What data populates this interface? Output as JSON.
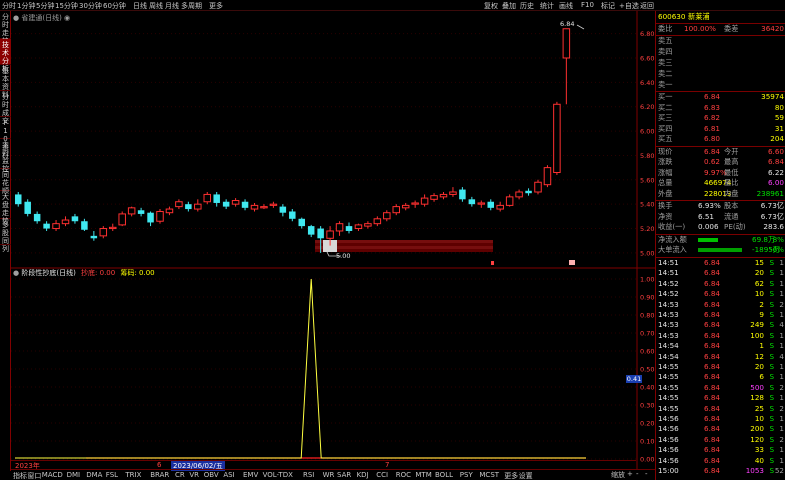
{
  "topbar": {
    "left": [
      "分时",
      "1分钟",
      "5分钟",
      "15分钟",
      "30分钟",
      "60分钟",
      "日线",
      "周线",
      "月线",
      "多周期",
      "更多"
    ],
    "right": [
      "复权",
      "叠加",
      "历史",
      "统计",
      "画线",
      "F10",
      "标记",
      "+自选",
      "返回"
    ]
  },
  "left_tabs": [
    "分时走势",
    "技术分析",
    "基本资料",
    "分时成交",
    "F10资料",
    "主力监控",
    "同花顺",
    "大盘走势",
    "多股同列"
  ],
  "main_title": "省建通(日线)",
  "indicator": {
    "title": "阶段性抄底(日线)",
    "label1": "抄底: 0.00",
    "label2": "筹码: 0.00"
  },
  "low_marker": "5.00",
  "high_marker": "6.84",
  "axis_main": [
    "6.80",
    "6.60",
    "6.40",
    "6.20",
    "6.00",
    "5.80",
    "5.60",
    "5.40",
    "5.20",
    "5.00"
  ],
  "axis_ind": [
    "1.00",
    "0.90",
    "0.80",
    "0.70",
    "0.60",
    "0.50",
    "0.40",
    "0.30",
    "0.20",
    "0.10",
    "0.00"
  ],
  "ind_value_box": "0.41",
  "timeline": {
    "year": "2023年",
    "m6": "6",
    "date": "2023/06/02/五",
    "m7": "7"
  },
  "bottombar": [
    "指标",
    "窗口",
    "MACD",
    "DMI",
    "DMA",
    "FSL",
    "TRIX",
    "BRAR",
    "CR",
    "VR",
    "OBV",
    "ASI",
    "EMV",
    "VOL-TDX",
    "RSI",
    "WR",
    "SAR",
    "KDJ",
    "CCI",
    "ROC",
    "MTM",
    "BOLL",
    "PSY",
    "MCST",
    "更多",
    "设置"
  ],
  "bottom_right": [
    "缩放",
    "+",
    "-",
    "-"
  ],
  "panel": {
    "code": "600630",
    "name": "新莱浦",
    "webi_label": "委比",
    "webi_val": "100.00%",
    "weicha_label": "委差",
    "weicha_val": "36420",
    "sells": [
      {
        "l": "卖五",
        "p": "",
        "v": ""
      },
      {
        "l": "卖四",
        "p": "",
        "v": ""
      },
      {
        "l": "卖三",
        "p": "",
        "v": ""
      },
      {
        "l": "卖二",
        "p": "",
        "v": ""
      },
      {
        "l": "卖一",
        "p": "",
        "v": ""
      }
    ],
    "buys": [
      {
        "l": "买一",
        "p": "6.84",
        "v": "35974"
      },
      {
        "l": "买二",
        "p": "6.83",
        "v": "80"
      },
      {
        "l": "买三",
        "p": "6.82",
        "v": "59"
      },
      {
        "l": "买四",
        "p": "6.81",
        "v": "31"
      },
      {
        "l": "买五",
        "p": "6.80",
        "v": "204"
      }
    ],
    "stats": [
      {
        "a": "现价",
        "av": "6.84",
        "b": "今开",
        "bv": "6.60"
      },
      {
        "a": "涨跌",
        "av": "0.62",
        "b": "最高",
        "bv": "6.84"
      },
      {
        "a": "涨幅",
        "av": "9.97%",
        "b": "最低",
        "bv": "6.22"
      },
      {
        "a": "总量",
        "av": "466974",
        "b": "量比",
        "bv": "6.00"
      },
      {
        "a": "外盘",
        "av": "228013",
        "b": "内盘",
        "bv": "238961"
      }
    ],
    "stats2": [
      {
        "a": "换手",
        "av": "6.93%",
        "b": "股本",
        "bv": "6.73亿"
      },
      {
        "a": "净资",
        "av": "6.51",
        "b": "流通",
        "bv": "6.73亿"
      },
      {
        "a": "收益(一)",
        "av": "0.006",
        "b": "PE(动)",
        "bv": "283.6"
      }
    ],
    "flow": [
      {
        "l": "净流入额",
        "v": "69.8万",
        "p": "8%"
      },
      {
        "l": "大单流入",
        "v": "-1895万",
        "p": "-6%"
      }
    ],
    "ticks": [
      [
        "14:51",
        "6.84",
        "15",
        "S",
        "1"
      ],
      [
        "14:51",
        "6.84",
        "20",
        "S",
        "1"
      ],
      [
        "14:52",
        "6.84",
        "62",
        "S",
        "1"
      ],
      [
        "14:52",
        "6.84",
        "10",
        "S",
        "1"
      ],
      [
        "14:53",
        "6.84",
        "2",
        "S",
        "2"
      ],
      [
        "14:53",
        "6.84",
        "9",
        "S",
        "1"
      ],
      [
        "14:53",
        "6.84",
        "249",
        "S",
        "4"
      ],
      [
        "14:53",
        "6.84",
        "100",
        "S",
        "1"
      ],
      [
        "14:54",
        "6.84",
        "1",
        "S",
        "1"
      ],
      [
        "14:54",
        "6.84",
        "12",
        "S",
        "4"
      ],
      [
        "14:55",
        "6.84",
        "20",
        "S",
        "1"
      ],
      [
        "14:55",
        "6.84",
        "6",
        "S",
        "1"
      ],
      [
        "14:55",
        "6.84",
        "500",
        "S",
        "2"
      ],
      [
        "14:55",
        "6.84",
        "128",
        "S",
        "1"
      ],
      [
        "14:55",
        "6.84",
        "25",
        "S",
        "2"
      ],
      [
        "14:56",
        "6.84",
        "10",
        "S",
        "1"
      ],
      [
        "14:56",
        "6.84",
        "200",
        "S",
        "1"
      ],
      [
        "14:56",
        "6.84",
        "120",
        "S",
        "2"
      ],
      [
        "14:56",
        "6.84",
        "33",
        "S",
        "1"
      ],
      [
        "14:56",
        "6.84",
        "40",
        "S",
        "1"
      ],
      [
        "15:00",
        "6.84",
        "1053",
        "S",
        "52"
      ]
    ]
  },
  "chart_data": {
    "type": "candlestick",
    "title": "省建通(日线)",
    "ylim": [
      4.95,
      6.92
    ],
    "candles": [
      [
        5.48,
        5.4,
        5.5,
        5.38
      ],
      [
        5.42,
        5.32,
        5.44,
        5.3
      ],
      [
        5.32,
        5.26,
        5.34,
        5.24
      ],
      [
        5.24,
        5.2,
        5.26,
        5.18
      ],
      [
        5.2,
        5.24,
        5.27,
        5.18
      ],
      [
        5.24,
        5.27,
        5.3,
        5.22
      ],
      [
        5.3,
        5.26,
        5.32,
        5.24
      ],
      [
        5.26,
        5.19,
        5.28,
        5.18
      ],
      [
        5.14,
        5.12,
        5.18,
        5.1
      ],
      [
        5.14,
        5.2,
        5.22,
        5.12
      ],
      [
        5.2,
        5.21,
        5.24,
        5.18
      ],
      [
        5.23,
        5.32,
        5.34,
        5.22
      ],
      [
        5.32,
        5.37,
        5.38,
        5.3
      ],
      [
        5.35,
        5.32,
        5.37,
        5.3
      ],
      [
        5.33,
        5.25,
        5.34,
        5.22
      ],
      [
        5.26,
        5.34,
        5.36,
        5.24
      ],
      [
        5.33,
        5.36,
        5.38,
        5.31
      ],
      [
        5.38,
        5.42,
        5.44,
        5.36
      ],
      [
        5.4,
        5.36,
        5.42,
        5.34
      ],
      [
        5.36,
        5.4,
        5.44,
        5.34
      ],
      [
        5.42,
        5.48,
        5.5,
        5.4
      ],
      [
        5.48,
        5.41,
        5.5,
        5.38
      ],
      [
        5.42,
        5.38,
        5.44,
        5.36
      ],
      [
        5.4,
        5.43,
        5.45,
        5.38
      ],
      [
        5.42,
        5.37,
        5.44,
        5.35
      ],
      [
        5.36,
        5.39,
        5.41,
        5.34
      ],
      [
        5.37,
        5.38,
        5.4,
        5.36
      ],
      [
        5.39,
        5.4,
        5.42,
        5.37
      ],
      [
        5.38,
        5.33,
        5.4,
        5.3
      ],
      [
        5.34,
        5.28,
        5.36,
        5.26
      ],
      [
        5.28,
        5.22,
        5.29,
        5.2
      ],
      [
        5.22,
        5.15,
        5.23,
        5.13
      ],
      [
        5.2,
        5.12,
        5.22,
        5.0
      ],
      [
        5.12,
        5.18,
        5.22,
        5.06
      ],
      [
        5.18,
        5.24,
        5.26,
        5.14
      ],
      [
        5.22,
        5.18,
        5.25,
        5.16
      ],
      [
        5.2,
        5.23,
        5.24,
        5.18
      ],
      [
        5.22,
        5.24,
        5.26,
        5.2
      ],
      [
        5.24,
        5.28,
        5.3,
        5.22
      ],
      [
        5.28,
        5.33,
        5.35,
        5.26
      ],
      [
        5.33,
        5.38,
        5.4,
        5.31
      ],
      [
        5.37,
        5.39,
        5.41,
        5.35
      ],
      [
        5.4,
        5.41,
        5.43,
        5.37
      ],
      [
        5.4,
        5.45,
        5.48,
        5.38
      ],
      [
        5.44,
        5.47,
        5.49,
        5.42
      ],
      [
        5.46,
        5.48,
        5.5,
        5.44
      ],
      [
        5.48,
        5.5,
        5.54,
        5.46
      ],
      [
        5.52,
        5.44,
        5.54,
        5.42
      ],
      [
        5.44,
        5.4,
        5.46,
        5.38
      ],
      [
        5.4,
        5.41,
        5.43,
        5.37
      ],
      [
        5.42,
        5.37,
        5.44,
        5.35
      ],
      [
        5.36,
        5.39,
        5.42,
        5.34
      ],
      [
        5.39,
        5.46,
        5.48,
        5.38
      ],
      [
        5.46,
        5.5,
        5.52,
        5.44
      ],
      [
        5.51,
        5.49,
        5.53,
        5.47
      ],
      [
        5.5,
        5.58,
        5.6,
        5.48
      ],
      [
        5.56,
        5.7,
        5.72,
        5.54
      ],
      [
        5.66,
        6.22,
        6.24,
        5.64
      ],
      [
        6.6,
        6.84,
        6.84,
        6.22
      ]
    ],
    "indicator": {
      "name": "阶段性抄底",
      "ylim": [
        0,
        1.05
      ],
      "spike_index": 31,
      "spike_value": 1.0,
      "values": "0 except spike"
    }
  }
}
